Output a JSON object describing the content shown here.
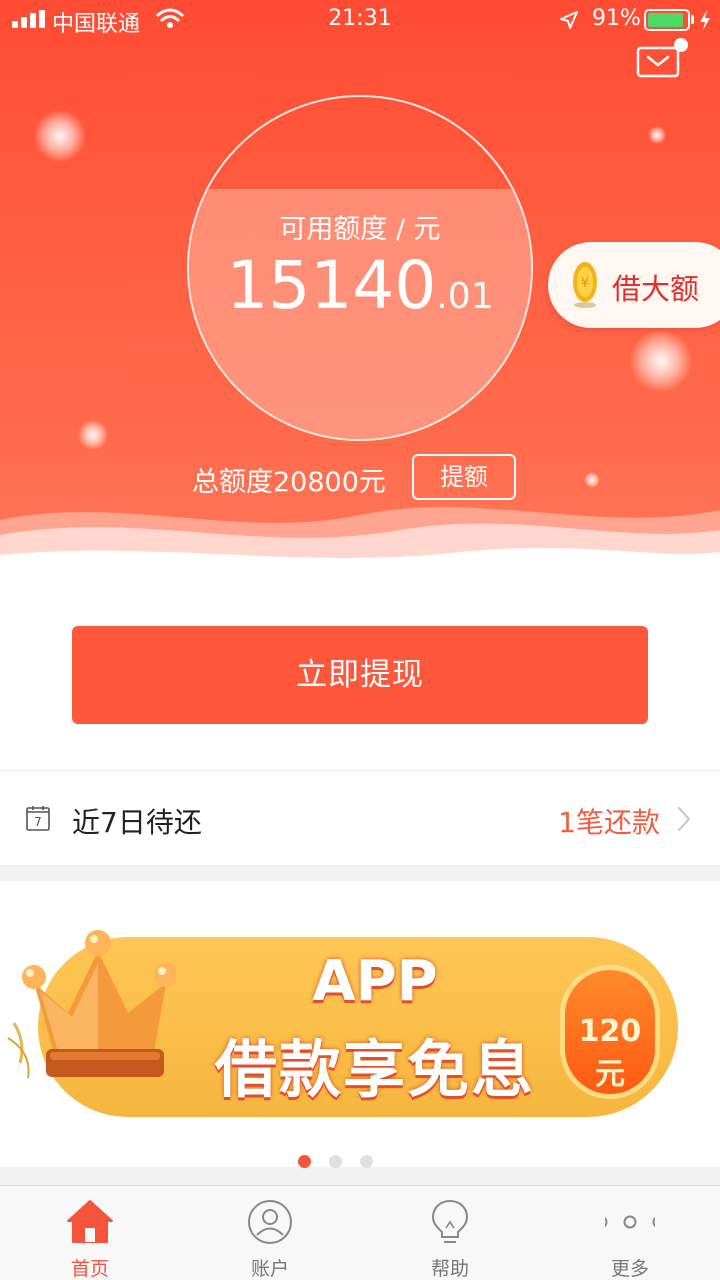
{
  "status_bar": {
    "carrier": "中国联通",
    "time": "21:31",
    "battery_percent": "91%",
    "battery_level": 0.91,
    "signal_bars": 4
  },
  "header": {
    "message_icon": "envelope-icon",
    "credit_label": "可用额度 / 元",
    "credit_integer": "15140",
    "credit_decimal": ".01",
    "total_limit": "总额度20800元",
    "raise_limit_label": "提额",
    "big_loan_label": "借大额",
    "big_loan_icon": "yuan-coin-icon"
  },
  "withdraw": {
    "button_label": "立即提现"
  },
  "repayment": {
    "calendar_day": "7",
    "label": "近7日待还",
    "count_label": "1笔还款",
    "icon": "chevron-right-icon"
  },
  "banner": {
    "title_line1": "APP",
    "title_line2": "借款享免息",
    "badge": "120元",
    "page_count": 3,
    "active_page": 1
  },
  "tab_bar": {
    "tabs": [
      {
        "label": "首页",
        "icon": "home-icon",
        "active": true
      },
      {
        "label": "账户",
        "icon": "user-icon",
        "active": false
      },
      {
        "label": "帮助",
        "icon": "lightbulb-icon",
        "active": false
      },
      {
        "label": "更多",
        "icon": "more-dots-icon",
        "active": false
      }
    ]
  },
  "colors": {
    "primary": "#fd573c",
    "accent_text": "#f06040",
    "active_tab": "#f4543c"
  }
}
